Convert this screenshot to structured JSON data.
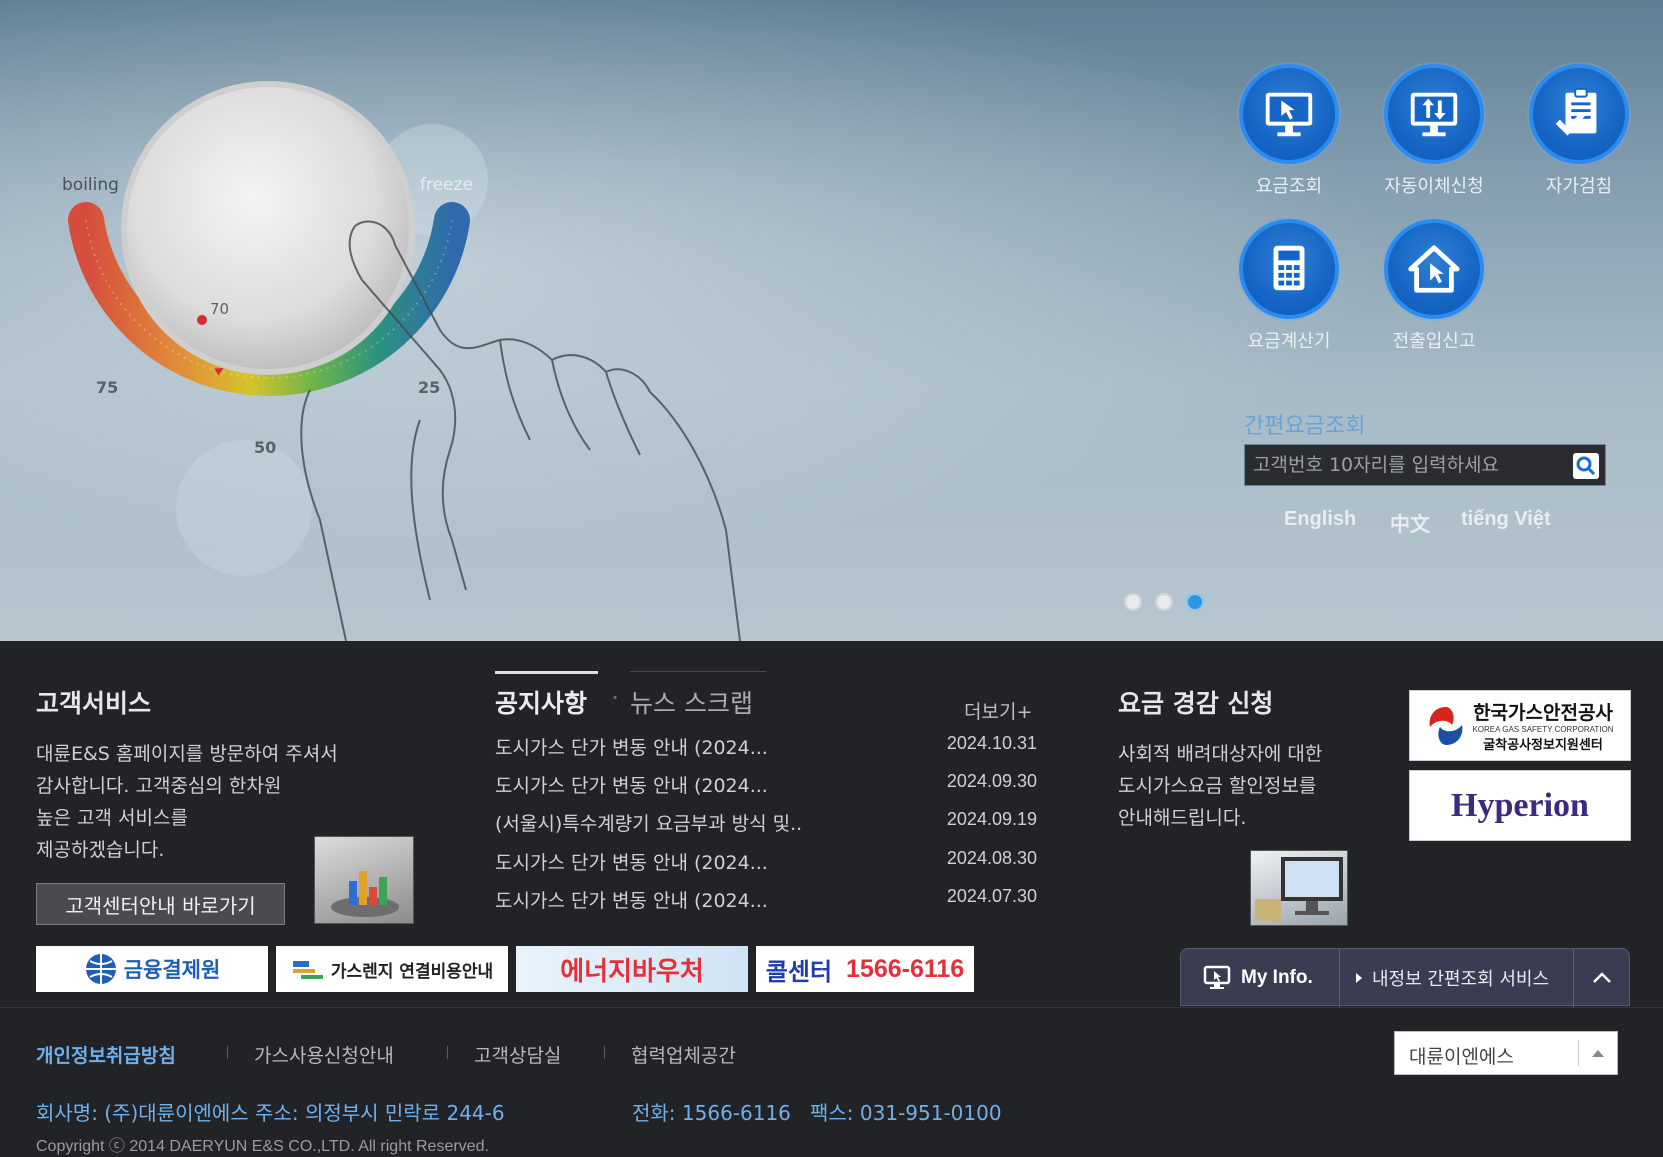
{
  "hero": {
    "dial": {
      "label_left": "boiling",
      "label_right": "freeze",
      "pointer_value": "70",
      "tick_75": "75",
      "tick_50": "50",
      "tick_25": "25"
    },
    "quick_buttons": [
      {
        "label": "요금조회",
        "icon": "monitor-cursor-icon"
      },
      {
        "label": "자동이체신청",
        "icon": "monitor-transfer-icon"
      },
      {
        "label": "자가검침",
        "icon": "clipboard-check-icon"
      },
      {
        "label": "요금계산기",
        "icon": "calculator-icon"
      },
      {
        "label": "전출입신고",
        "icon": "house-cursor-icon"
      }
    ],
    "quick_search": {
      "title": "간편요금조회",
      "placeholder": "고객번호 10자리를 입력하세요"
    },
    "languages": [
      "English",
      "中文",
      "tiếng Việt"
    ],
    "slider": {
      "count": 3,
      "active": 3
    }
  },
  "customer_service": {
    "title": "고객서비스",
    "lines": [
      "대륜E&S 홈페이지를 방문하여 주셔서",
      "감사합니다. 고객중심의 한차원",
      "높은 고객 서비스를",
      "제공하겠습니다."
    ],
    "button": "고객센터안내 바로가기"
  },
  "notices": {
    "tabs": [
      "공지사항",
      "뉴스 스크랩"
    ],
    "separator": "·",
    "more": "더보기+",
    "items": [
      {
        "title": "도시가스 단가 변동 안내 (2024...",
        "date": "2024.10.31"
      },
      {
        "title": "도시가스 단가 변동 안내 (2024...",
        "date": "2024.09.30"
      },
      {
        "title": "(서울시)특수계량기 요금부과 방식 및..",
        "date": "2024.09.19"
      },
      {
        "title": "도시가스 단가 변동 안내 (2024...",
        "date": "2024.08.30"
      },
      {
        "title": "도시가스 단가 변동 안내 (2024...",
        "date": "2024.07.30"
      }
    ]
  },
  "discount": {
    "title": "요금 경감 신청",
    "lines": [
      "사회적 배려대상자에 대한",
      "도시가스요금 할인정보를",
      "안내해드립니다."
    ]
  },
  "partners": {
    "kgs_name": "한국가스안전공사",
    "kgs_en": "KOREA GAS SAFETY CORPORATION",
    "kgs_sub": "굴착공사정보지원센터",
    "hyperion": "Hyperion"
  },
  "banners": {
    "b1": "금융결제원",
    "b2": "가스렌지 연결비용안내",
    "b3": "에너지바우처",
    "b4_label": "콜센터",
    "b4_number": "1566-6116"
  },
  "myinfo": {
    "label": "My Info.",
    "service": "내정보 간편조회 서비스"
  },
  "footer": {
    "links": [
      "개인정보취급방침",
      "가스사용신청안내",
      "고객상담실",
      "협력업체공간"
    ],
    "family_site": "대륜이엔에스",
    "address": "회사명: (주)대륜이엔에스 주소: 의정부시 민락로 244-6",
    "phone": "전화: 1566-6116   팩스: 031-951-0100",
    "copyright": "Copyright ⓒ 2014 DAERYUN E&S CO.,LTD. All right Reserved."
  },
  "colors": {
    "accent_blue": "#1665c4",
    "link_blue": "#6fb0ea",
    "dark_bg": "#222327"
  }
}
